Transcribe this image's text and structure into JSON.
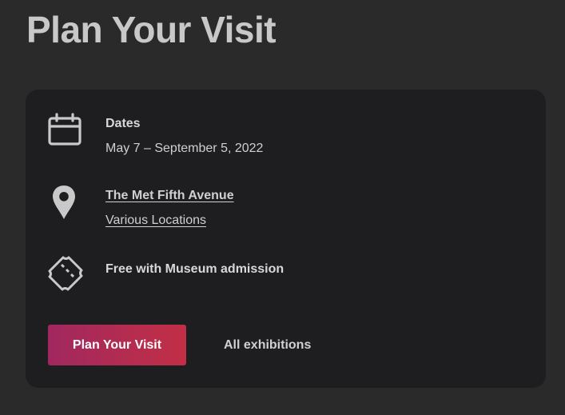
{
  "page": {
    "title": "Plan Your Visit"
  },
  "visit_card": {
    "dates": {
      "icon": "calendar-icon",
      "label": "Dates",
      "value": "May 7 – September 5, 2022"
    },
    "location": {
      "icon": "map-pin-icon",
      "primary_link": "The Met Fifth Avenue",
      "secondary_link": "Various Locations"
    },
    "admission": {
      "icon": "ticket-icon",
      "label": "Free with Museum admission"
    },
    "actions": {
      "primary_label": "Plan Your Visit",
      "secondary_label": "All exhibitions"
    }
  },
  "colors": {
    "page_background": "#2a2a2a",
    "card_background": "#1e1e21",
    "button_gradient_start": "#a0285f",
    "button_gradient_end": "#c22f45",
    "text": "#d0d0d0"
  }
}
